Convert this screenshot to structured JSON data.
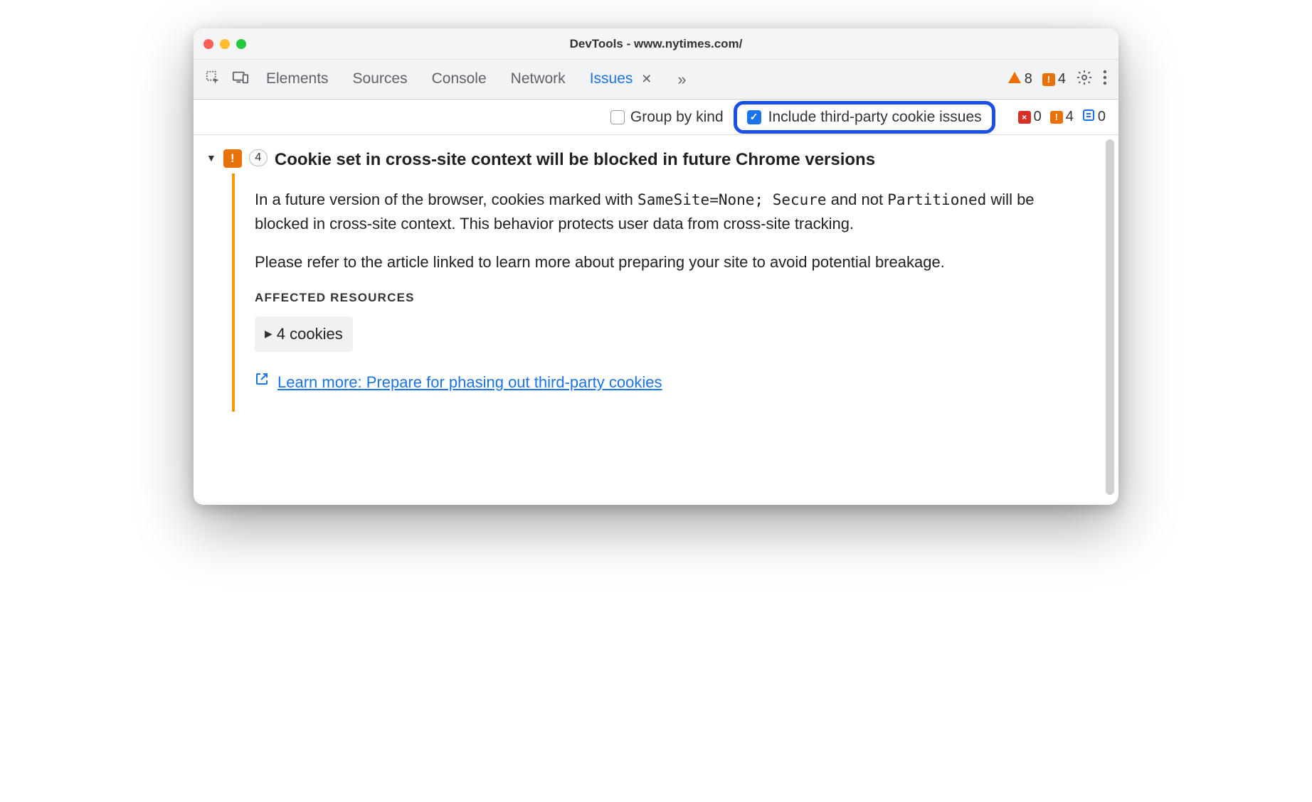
{
  "window": {
    "title": "DevTools - www.nytimes.com/"
  },
  "tabs": {
    "elements": "Elements",
    "sources": "Sources",
    "console": "Console",
    "network": "Network",
    "issues": "Issues"
  },
  "toolbar": {
    "warnings_count": "8",
    "breaking_count": "4"
  },
  "filterbar": {
    "group_by_kind": "Group by kind",
    "include_third_party": "Include third-party cookie issues",
    "counts": {
      "errors": "0",
      "warnings": "4",
      "info": "0"
    }
  },
  "issue": {
    "count": "4",
    "title": "Cookie set in cross-site context will be blocked in future Chrome versions",
    "para1_prefix": "In a future version of the browser, cookies marked with ",
    "code1": "SameSite=None; Secure",
    "para1_mid": " and not ",
    "code2": "Partitioned",
    "para1_suffix": " will be blocked in cross-site context. This behavior protects user data from cross-site tracking.",
    "para2": "Please refer to the article linked to learn more about preparing your site to avoid potential breakage.",
    "affected_resources_heading": "AFFECTED RESOURCES",
    "cookies_label": "4 cookies",
    "learn_more": "Learn more: Prepare for phasing out third-party cookies"
  }
}
